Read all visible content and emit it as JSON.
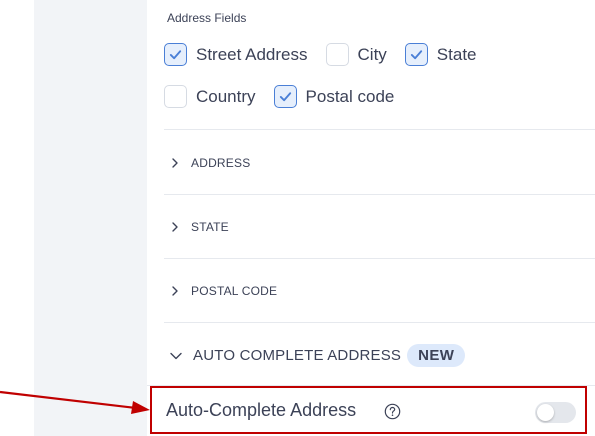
{
  "address_fields": {
    "title": "Address Fields",
    "options": [
      {
        "label": "Street Address",
        "checked": true
      },
      {
        "label": "City",
        "checked": false
      },
      {
        "label": "State",
        "checked": true
      },
      {
        "label": "Country",
        "checked": false
      },
      {
        "label": "Postal code",
        "checked": true
      }
    ]
  },
  "sections": [
    {
      "label": "ADDRESS",
      "expanded": false
    },
    {
      "label": "STATE",
      "expanded": false
    },
    {
      "label": "POSTAL CODE",
      "expanded": false
    },
    {
      "label": "AUTO COMPLETE ADDRESS",
      "expanded": true,
      "badge": "NEW"
    }
  ],
  "auto_complete": {
    "label": "Auto-Complete Address",
    "help_icon": "question-circle-icon",
    "toggle_on": false
  },
  "colors": {
    "accent": "#4a7fd6",
    "checkbox_checked_bg": "#e6effc",
    "badge_bg": "#dde9fb",
    "annotation_red": "#c00000"
  }
}
